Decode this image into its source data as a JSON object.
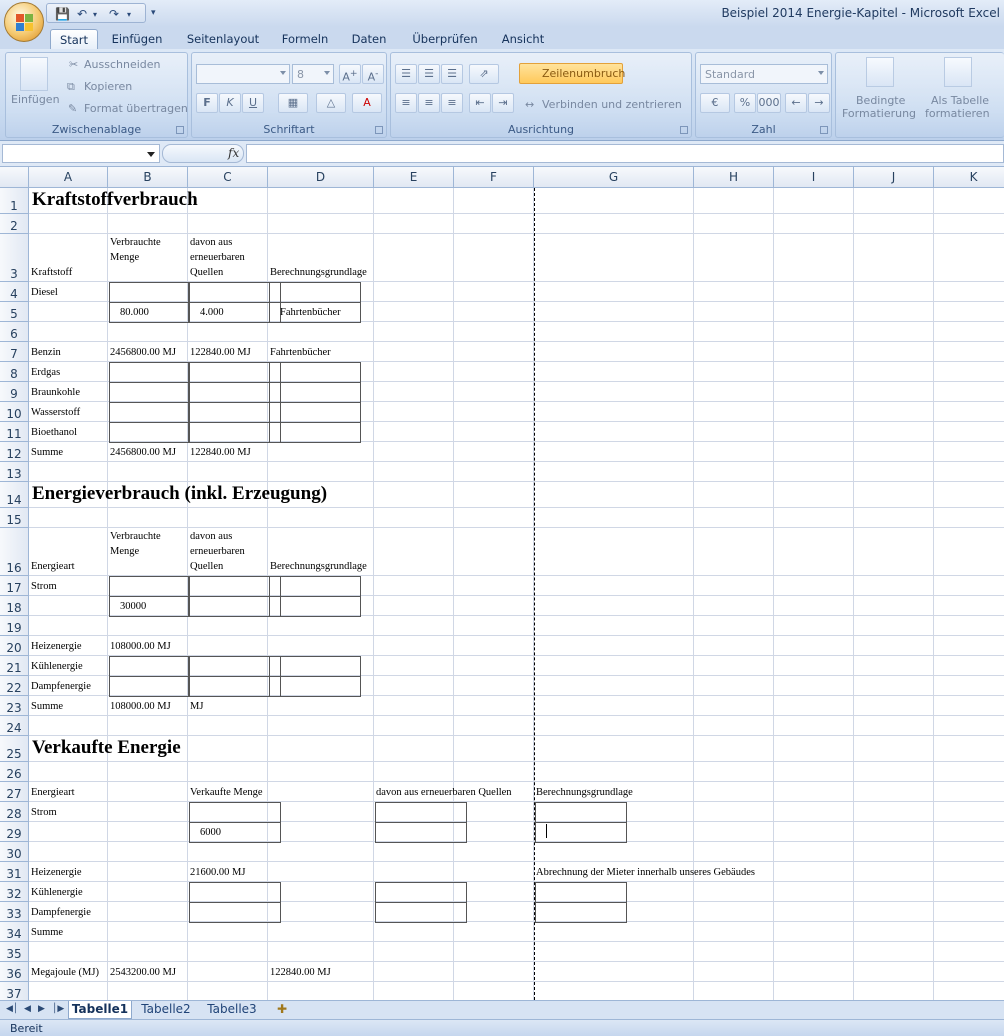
{
  "window": {
    "title": "Beispiel 2014 Energie-Kapitel - Microsoft Excel"
  },
  "ribbon_tabs": [
    "Start",
    "Einfügen",
    "Seitenlayout",
    "Formeln",
    "Daten",
    "Überprüfen",
    "Ansicht"
  ],
  "active_tab": "Start",
  "clipboard": {
    "paste": "Einfügen",
    "cut": "Ausschneiden",
    "copy": "Kopieren",
    "format_painter": "Format übertragen",
    "label": "Zwischenablage"
  },
  "font": {
    "name": "",
    "size": "8",
    "label": "Schriftart",
    "bold": "F",
    "italic": "K",
    "underline": "U"
  },
  "alignment": {
    "wrap_text": "Zeilenumbruch",
    "merge_center": "Verbinden und zentrieren",
    "label": "Ausrichtung"
  },
  "number": {
    "format": "Standard",
    "percent": "%",
    "thousands": "000",
    "label": "Zahl"
  },
  "styles": {
    "conditional_line1": "Bedingte",
    "conditional_line2": "Formatierung",
    "table_line1": "Als Tabelle",
    "table_line2": "formatieren"
  },
  "formula_bar": {
    "name_box": "",
    "fx": "fx",
    "content": ""
  },
  "columns": [
    "A",
    "B",
    "C",
    "D",
    "E",
    "F",
    "G",
    "H",
    "I",
    "J",
    "K"
  ],
  "rows": [
    "1",
    "2",
    "3",
    "4",
    "5",
    "6",
    "7",
    "8",
    "9",
    "10",
    "11",
    "12",
    "13",
    "14",
    "15",
    "16",
    "17",
    "18",
    "19",
    "20",
    "21",
    "22",
    "23",
    "24",
    "25",
    "26",
    "27",
    "28",
    "29",
    "30",
    "31",
    "32",
    "33",
    "34",
    "35",
    "36",
    "37"
  ],
  "cells": {
    "A1": "Kraftstoffverbrauch",
    "A3": "Kraftstoff",
    "B3": "Verbrauchte Menge",
    "C3": "davon aus erneuerbaren Quellen",
    "D3": "Berechnungsgrundlage",
    "A4": "Diesel",
    "B5": "80.000",
    "C5": "4.000",
    "D5": "Fahrtenbücher",
    "A7": "Benzin",
    "B7": "2456800.00 MJ",
    "C7": "122840.00 MJ",
    "D7": "Fahrtenbücher",
    "A8": "Erdgas",
    "A9": "Braunkohle",
    "A10": "Wasserstoff",
    "A11": "Bioethanol",
    "A12": "Summe",
    "B12": "2456800.00 MJ",
    "C12": "122840.00 MJ",
    "A14": "Energieverbrauch (inkl. Erzeugung)",
    "A16": "Energieart",
    "B16": "Verbrauchte Menge",
    "C16": "davon aus erneuerbaren Quellen",
    "D16": "Berechnungsgrundlage",
    "A17": "Strom",
    "B18": "30000",
    "A20": "Heizenergie",
    "B20": "108000.00 MJ",
    "A21": "Kühlenergie",
    "A22": "Dampfenergie",
    "A23": "Summe",
    "B23": "108000.00 MJ",
    "C23": "MJ",
    "A25": "Verkaufte Energie",
    "A27": "Energieart",
    "C27": "Verkaufte Menge",
    "E27": "davon aus erneuerbaren Quellen",
    "G27": "Berechnungsgrundlage",
    "A28": "Strom",
    "C29": "6000",
    "A31": "Heizenergie",
    "C31": "21600.00 MJ",
    "G31": "Abrechnung der Mieter innerhalb unseres Gebäudes",
    "A32": "Kühlenergie",
    "A33": "Dampfenergie",
    "A34": "Summe",
    "A36": "Megajoule (MJ)",
    "B36": "2543200.00 MJ",
    "D36": "122840.00 MJ"
  },
  "sheet_tabs": [
    "Tabelle1",
    "Tabelle2",
    "Tabelle3"
  ],
  "active_sheet": "Tabelle1",
  "status": "Bereit"
}
